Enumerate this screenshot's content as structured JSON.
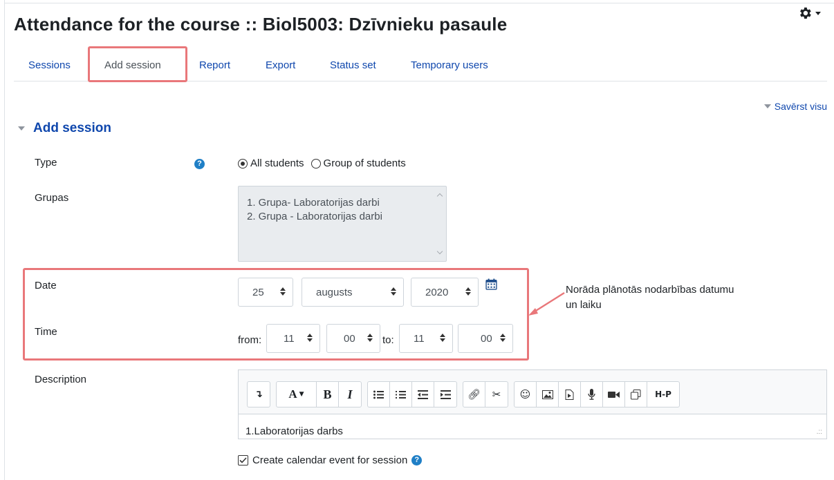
{
  "page": {
    "title": "Attendance for the course :: Biol5003: Dzīvnieku pasaule"
  },
  "tabs": [
    {
      "label": "Sessions"
    },
    {
      "label": "Add session"
    },
    {
      "label": "Report"
    },
    {
      "label": "Export"
    },
    {
      "label": "Status set"
    },
    {
      "label": "Temporary users"
    }
  ],
  "active_tab": "Add session",
  "collapse_all": "Savērst visu",
  "section": {
    "title": "Add session"
  },
  "form": {
    "type": {
      "label": "Type",
      "options": [
        "All students",
        "Group of students"
      ],
      "selected": "All students"
    },
    "groups": {
      "label": "Grupas",
      "options": [
        "1. Grupa- Laboratorijas darbi",
        "2. Grupa - Laboratorijas darbi"
      ]
    },
    "date": {
      "label": "Date",
      "day": "25",
      "month": "augusts",
      "year": "2020"
    },
    "time": {
      "label": "Time",
      "from_label": "from:",
      "to_label": "to:",
      "from_hour": "11",
      "from_minute": "00",
      "to_hour": "11",
      "to_minute": "00"
    },
    "description": {
      "label": "Description",
      "content": "1.Laboratorijas darbs"
    },
    "calendar_event": {
      "label": "Create calendar event for session",
      "checked": true
    }
  },
  "annotation": {
    "text": "Norāda plānotās nodarbības datumu un laiku"
  },
  "icons": {
    "settings": "gear-icon",
    "calendar": "calendar-icon",
    "help": "question-circle-icon"
  },
  "colors": {
    "link": "#0f47ad",
    "highlight": "#e9777a",
    "help": "#1f7fc6"
  }
}
